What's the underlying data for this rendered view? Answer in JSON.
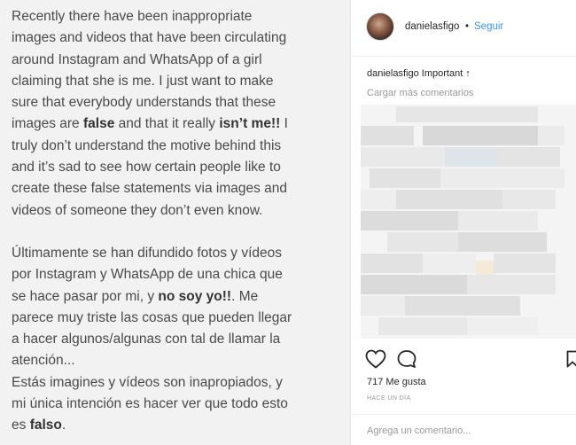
{
  "post_text": {
    "en": [
      "Recently there have been inappropriate",
      "images and videos that have been circulating",
      "around Instagram and WhatsApp of a girl",
      "claiming that she is me. I just want to make",
      "sure that everybody understands that these",
      "truly don’t understand the motive behind this",
      "and it’s sad to see how certain people like to",
      "create these false statements via images and",
      "videos of someone they don’t even know."
    ],
    "en_line6": {
      "a": "images are ",
      "b": "false",
      "c": " and that it really ",
      "d": "isn’t me!!",
      "e": " I"
    },
    "es": [
      "Últimamente se han difundido fotos y vídeos",
      "por Instagram y WhatsApp de una chica que",
      "parece muy triste las cosas que pueden llegar",
      "a hacer algunos/algunas con tal de llamar la",
      "atención...",
      "Estás imagines y vídeos son inapropiados, y",
      "mi única intención es hacer ver que todo esto"
    ],
    "es_line3": {
      "a": "se hace pasar por mi, y ",
      "b": "no soy yo!!",
      "c": ". Me"
    },
    "es_last": {
      "a": "es ",
      "b": "falso",
      "c": "."
    }
  },
  "header": {
    "username": "danielasfigo",
    "separator": "•",
    "follow_label": "Seguir"
  },
  "caption": {
    "username": "danielasfigo",
    "text": "Important ↑"
  },
  "load_more_label": "Cargar más comentarios",
  "likes_label": "717 Me gusta",
  "timestamp": "HACE UN DÍA",
  "comment_placeholder": "Agrega un comentario...",
  "icons": {
    "like": "heart-icon",
    "comment": "comment-icon",
    "save": "bookmark-icon"
  },
  "colors": {
    "link": "#3897f0",
    "text": "#262626",
    "muted": "#999999"
  }
}
